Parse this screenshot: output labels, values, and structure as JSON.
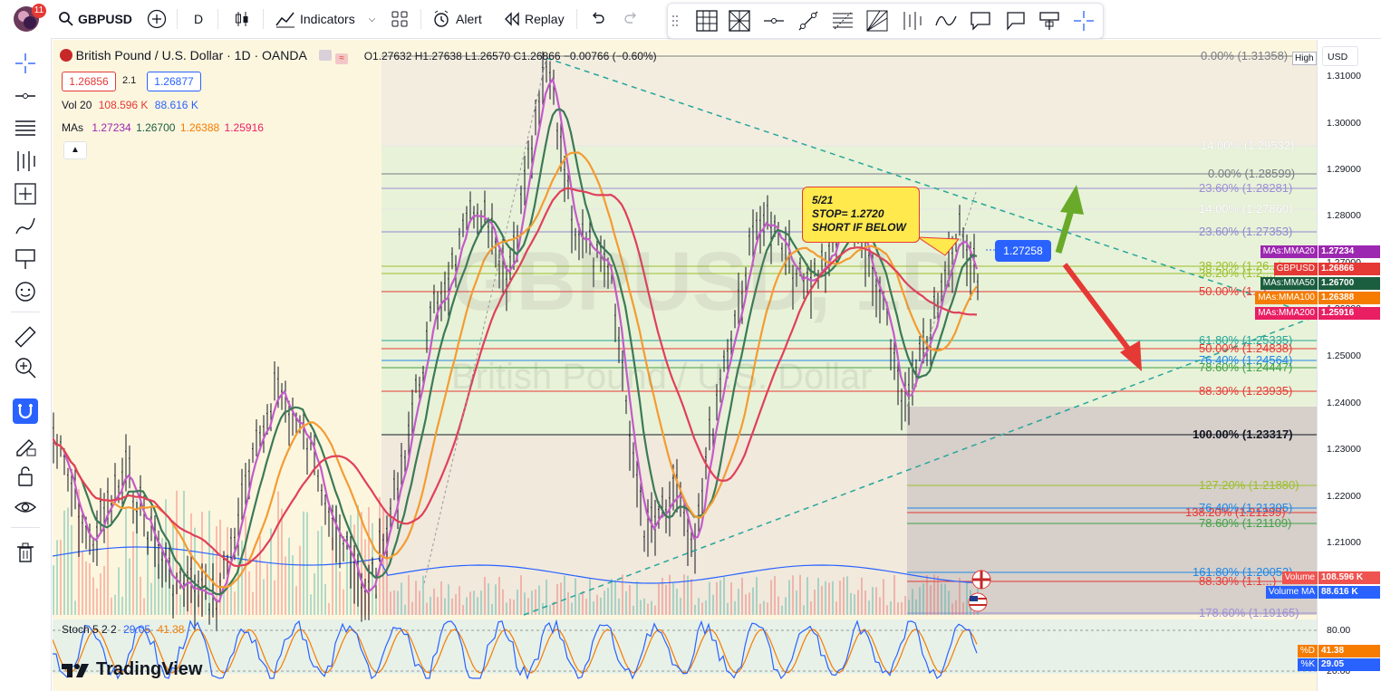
{
  "header": {
    "notification_count": "11",
    "symbol": "GBPUSD",
    "interval": "D",
    "indicators_label": "Indicators",
    "alert_label": "Alert",
    "replay_label": "Replay"
  },
  "legend": {
    "title": "British Pound / U.S. Dollar · 1D · OANDA",
    "ohlc": "O1.27632  H1.27638  L1.26570  C1.26866  −0.00766 (−0.60%)",
    "bid": "1.26856",
    "spread": "2.1",
    "ask": "1.26877",
    "vol_label": "Vol 20",
    "vol_value": "108.596 K",
    "vol_ma_value": "88.616 K",
    "mas_label": "MAs",
    "ma20": "1.27234",
    "ma50": "1.26700",
    "ma100": "1.26388",
    "ma200": "1.25916",
    "stoch_label": "Stoch 5 2 2",
    "stoch_k": "29.05",
    "stoch_d": "41.38"
  },
  "watermark": {
    "symbol": "GBPUSD, 1D",
    "name": "British Pound / U.S. Dollar"
  },
  "annotation": {
    "note": [
      "5/21",
      "STOP= 1.2720",
      "SHORT IF BELOW"
    ],
    "crosshair_price": "1.27258"
  },
  "fib_levels": [
    {
      "label": "0.00% (1.31358)",
      "color": "#787b86"
    },
    {
      "label": "14.00% (1.29532)",
      "color": "#ffffff"
    },
    {
      "label": "0.00% (1.28599)",
      "color": "#787b86"
    },
    {
      "label": "23.60% (1.28281)",
      "color": "#9b8fd6"
    },
    {
      "label": "14.00% (1.27860)",
      "color": "#ffffff"
    },
    {
      "label": "23.60% (1.27353)",
      "color": "#8e8ad0"
    },
    {
      "label": "38.20% (1.26...)",
      "color": "#9bbf2b"
    },
    {
      "label": "38.20% (1.2...)",
      "color": "#9bbf2b"
    },
    {
      "label": "50.00% (1...)",
      "color": "#e53935"
    },
    {
      "label": "61.80% (1.25335)",
      "color": "#26a69a"
    },
    {
      "label": "50.00% (1.24838)",
      "color": "#e53935"
    },
    {
      "label": "76.40% (1.24564)",
      "color": "#1e88e5"
    },
    {
      "label": "78.60% (1.24447)",
      "color": "#43a047"
    },
    {
      "label": "88.30% (1.23935)",
      "color": "#e53935"
    },
    {
      "label": "100.00% (1.23317)",
      "color": "#131722"
    },
    {
      "label": "127.20% (1.21880)",
      "color": "#9bbf2b"
    },
    {
      "label": "76.40% (1.21395)",
      "color": "#1e88e5"
    },
    {
      "label": "138.20% (1.21299)",
      "color": "#e53935"
    },
    {
      "label": "78.60% (1.21109)",
      "color": "#43a047"
    },
    {
      "label": "161.80% (1.20053)",
      "color": "#1e88e5"
    },
    {
      "label": "88.30% (1.1...)",
      "color": "#e53935"
    },
    {
      "label": "178.60% (1.19165)",
      "color": "#9b8fd6"
    }
  ],
  "price_scale": {
    "currency": "USD",
    "high_label": "High",
    "ticks": [
      "1.31000",
      "1.30000",
      "1.29000",
      "1.28000",
      "1.27000",
      "1.26000",
      "1.25000",
      "1.24000",
      "1.23000",
      "1.22000",
      "1.21000"
    ],
    "stoch_ticks": [
      "80.00",
      "20.00"
    ],
    "tags": [
      {
        "text": "MAs:MMA20",
        "value": "1.27234",
        "color": "#9c27b0"
      },
      {
        "text": "GBPUSD",
        "value": "1.26866",
        "color": "#e53935"
      },
      {
        "text": "MAs:MMA50",
        "value": "1.26700",
        "color": "#1b5e3f"
      },
      {
        "text": "MAs:MMA100",
        "value": "1.26388",
        "color": "#f57c00"
      },
      {
        "text": "MAs:MMA200",
        "value": "1.25916",
        "color": "#e91e63"
      },
      {
        "text": "Volume",
        "value": "108.596 K",
        "color": "#ef5350"
      },
      {
        "text": "Volume MA",
        "value": "88.616 K",
        "color": "#2962ff"
      },
      {
        "text": "%D",
        "value": "41.38",
        "color": "#f57c00"
      },
      {
        "text": "%K",
        "value": "29.05",
        "color": "#2962ff"
      }
    ]
  },
  "branding": "TradingView",
  "colors": {
    "accent": "#2962ff",
    "ma20": "#c35bc9",
    "ma50": "#3b7a57",
    "ma100": "#f39c33",
    "ma200": "#e0405a",
    "up_arrow": "#6aaa2a",
    "down_arrow": "#e53935",
    "trendline": "#26a69a"
  }
}
